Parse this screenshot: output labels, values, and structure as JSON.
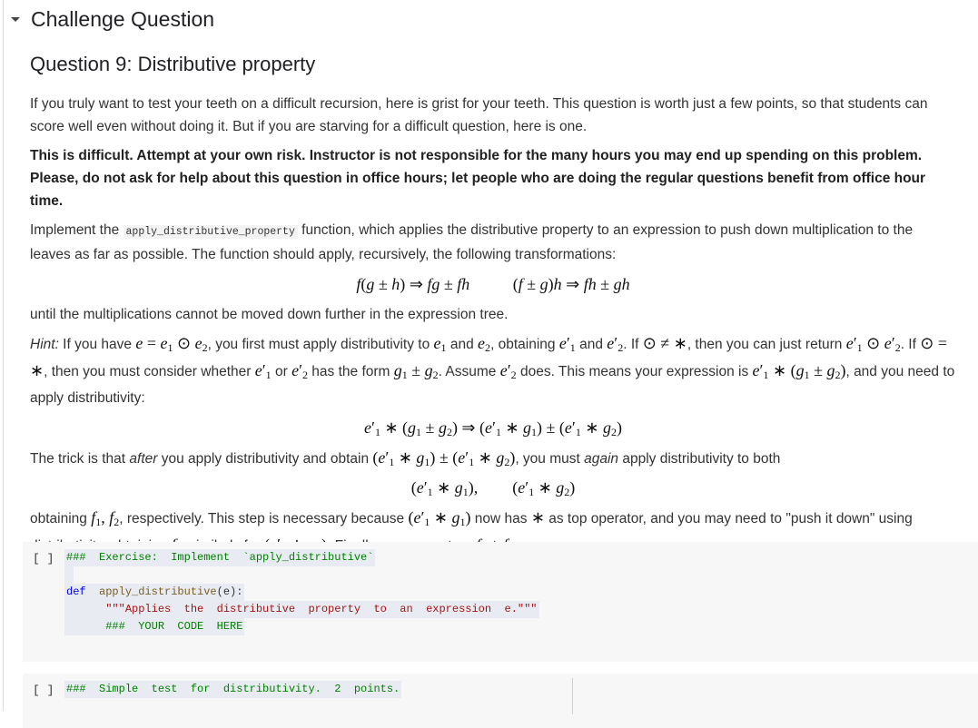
{
  "section": {
    "title": "Challenge Question",
    "toggle_icon": "caret-down-icon"
  },
  "question": {
    "title": "Question 9: Distributive property",
    "intro": "If you truly want to test your teeth on a difficult recursion, here is grist for your teeth. This question is worth just a few points, so that students can score well even without doing it. But if you are starving for a difficult question, here is one.",
    "warning": "This is difficult. Attempt at your own risk. Instructor is not responsible for the many hours you may end up spending on this problem. Please, do not ask for help about this question in office hours; let people who are doing the regular questions benefit from office hour time.",
    "implement_prefix": "Implement the ",
    "implement_code": "apply_distributive_property",
    "implement_suffix": " function, which applies the distributive property to an expression to push down multiplication to the leaves as far as possible. The function should apply, recursively, the following transformations:",
    "formula1": "f(g ± h) ⇒ fg ± fh",
    "formula2": "(f ± g)h ⇒ fh ± gh",
    "until_text": "until the multiplications cannot be moved down further in the expression tree.",
    "hint_label": "Hint:",
    "hint_t1": " If you have ",
    "hint_t2": ", you first must apply distributivity to ",
    "hint_t3": " and ",
    "hint_t4": ", obtaining ",
    "hint_t5": " and ",
    "hint_t6": ". If ",
    "hint_t7": ", then you can just return ",
    "hint_t8": ". If ",
    "hint_t9": ", then you must consider whether ",
    "hint_t10": " or ",
    "hint_t11": " has the form ",
    "hint_t12": ". Assume ",
    "hint_t13": " does. This means your expression is ",
    "hint_t14": ", and you need to apply distributivity:",
    "trick_t1": "The trick is that ",
    "trick_after": "after",
    "trick_t2": " you apply distributivity and obtain ",
    "trick_t3": ", you must ",
    "trick_again": "again",
    "trick_t4": " apply distributivity to both",
    "obtain_t1": "obtaining ",
    "obtain_t2": ", respectively. This step is necessary because ",
    "obtain_t3": " now has ",
    "obtain_t4": " as top operator, and you may need to \"push it down\" using distributivity, obtaining ",
    "obtain_t5": "; similarly for ",
    "obtain_t6": ". Finally, you can return ",
    "obtain_t7": "."
  },
  "cells": [
    {
      "run_label": "[ ]",
      "lines": [
        {
          "comment": "###  Exercise:  Implement  `apply_distributive`"
        },
        {
          "kw": "def",
          "fn": "apply_distributive",
          "args": "(e):"
        },
        {
          "docstring": "\"\"\"Applies  the  distributive  property  to  an  expression  e.\"\"\""
        },
        {
          "comment": "###  YOUR  CODE  HERE"
        }
      ]
    },
    {
      "run_label": "[ ]",
      "lines": [
        {
          "comment": "###  Simple  test  for  distributivity.  2  points."
        }
      ]
    }
  ]
}
